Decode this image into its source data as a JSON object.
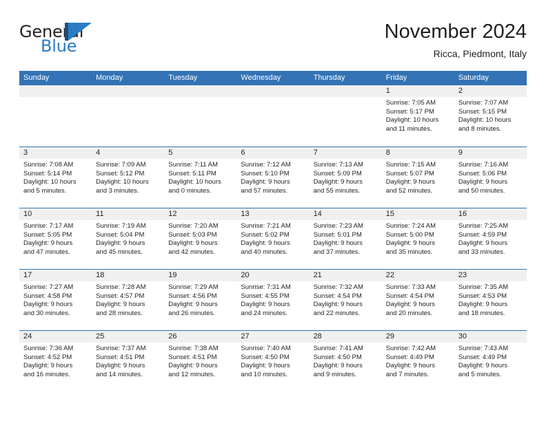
{
  "brand": {
    "name_part1": "General",
    "name_part2": "Blue",
    "logo_icon": "general-blue-triangle-logo",
    "dark_blue": "#1a4f86",
    "accent_blue": "#2b7cc4"
  },
  "header": {
    "month_title": "November 2024",
    "location": "Ricca, Piedmont, Italy"
  },
  "theme": {
    "header_row_blue": "#3373b5",
    "day_strip_gray": "#f0f0f0",
    "text_color": "#231f20"
  },
  "weekdays": [
    {
      "label": "Sunday"
    },
    {
      "label": "Monday"
    },
    {
      "label": "Tuesday"
    },
    {
      "label": "Wednesday"
    },
    {
      "label": "Thursday"
    },
    {
      "label": "Friday"
    },
    {
      "label": "Saturday"
    }
  ],
  "weeks": [
    {
      "days": [
        {
          "number": "",
          "sunrise": "",
          "sunset": "",
          "daylight_line1": "",
          "daylight_line2": "",
          "empty": true
        },
        {
          "number": "",
          "sunrise": "",
          "sunset": "",
          "daylight_line1": "",
          "daylight_line2": "",
          "empty": true
        },
        {
          "number": "",
          "sunrise": "",
          "sunset": "",
          "daylight_line1": "",
          "daylight_line2": "",
          "empty": true
        },
        {
          "number": "",
          "sunrise": "",
          "sunset": "",
          "daylight_line1": "",
          "daylight_line2": "",
          "empty": true
        },
        {
          "number": "",
          "sunrise": "",
          "sunset": "",
          "daylight_line1": "",
          "daylight_line2": "",
          "empty": true
        },
        {
          "number": "1",
          "sunrise": "Sunrise: 7:05 AM",
          "sunset": "Sunset: 5:17 PM",
          "daylight_line1": "Daylight: 10 hours",
          "daylight_line2": "and 11 minutes.",
          "empty": false
        },
        {
          "number": "2",
          "sunrise": "Sunrise: 7:07 AM",
          "sunset": "Sunset: 5:15 PM",
          "daylight_line1": "Daylight: 10 hours",
          "daylight_line2": "and 8 minutes.",
          "empty": false
        }
      ]
    },
    {
      "days": [
        {
          "number": "3",
          "sunrise": "Sunrise: 7:08 AM",
          "sunset": "Sunset: 5:14 PM",
          "daylight_line1": "Daylight: 10 hours",
          "daylight_line2": "and 5 minutes.",
          "empty": false
        },
        {
          "number": "4",
          "sunrise": "Sunrise: 7:09 AM",
          "sunset": "Sunset: 5:12 PM",
          "daylight_line1": "Daylight: 10 hours",
          "daylight_line2": "and 3 minutes.",
          "empty": false
        },
        {
          "number": "5",
          "sunrise": "Sunrise: 7:11 AM",
          "sunset": "Sunset: 5:11 PM",
          "daylight_line1": "Daylight: 10 hours",
          "daylight_line2": "and 0 minutes.",
          "empty": false
        },
        {
          "number": "6",
          "sunrise": "Sunrise: 7:12 AM",
          "sunset": "Sunset: 5:10 PM",
          "daylight_line1": "Daylight: 9 hours",
          "daylight_line2": "and 57 minutes.",
          "empty": false
        },
        {
          "number": "7",
          "sunrise": "Sunrise: 7:13 AM",
          "sunset": "Sunset: 5:09 PM",
          "daylight_line1": "Daylight: 9 hours",
          "daylight_line2": "and 55 minutes.",
          "empty": false
        },
        {
          "number": "8",
          "sunrise": "Sunrise: 7:15 AM",
          "sunset": "Sunset: 5:07 PM",
          "daylight_line1": "Daylight: 9 hours",
          "daylight_line2": "and 52 minutes.",
          "empty": false
        },
        {
          "number": "9",
          "sunrise": "Sunrise: 7:16 AM",
          "sunset": "Sunset: 5:06 PM",
          "daylight_line1": "Daylight: 9 hours",
          "daylight_line2": "and 50 minutes.",
          "empty": false
        }
      ]
    },
    {
      "days": [
        {
          "number": "10",
          "sunrise": "Sunrise: 7:17 AM",
          "sunset": "Sunset: 5:05 PM",
          "daylight_line1": "Daylight: 9 hours",
          "daylight_line2": "and 47 minutes.",
          "empty": false
        },
        {
          "number": "11",
          "sunrise": "Sunrise: 7:19 AM",
          "sunset": "Sunset: 5:04 PM",
          "daylight_line1": "Daylight: 9 hours",
          "daylight_line2": "and 45 minutes.",
          "empty": false
        },
        {
          "number": "12",
          "sunrise": "Sunrise: 7:20 AM",
          "sunset": "Sunset: 5:03 PM",
          "daylight_line1": "Daylight: 9 hours",
          "daylight_line2": "and 42 minutes.",
          "empty": false
        },
        {
          "number": "13",
          "sunrise": "Sunrise: 7:21 AM",
          "sunset": "Sunset: 5:02 PM",
          "daylight_line1": "Daylight: 9 hours",
          "daylight_line2": "and 40 minutes.",
          "empty": false
        },
        {
          "number": "14",
          "sunrise": "Sunrise: 7:23 AM",
          "sunset": "Sunset: 5:01 PM",
          "daylight_line1": "Daylight: 9 hours",
          "daylight_line2": "and 37 minutes.",
          "empty": false
        },
        {
          "number": "15",
          "sunrise": "Sunrise: 7:24 AM",
          "sunset": "Sunset: 5:00 PM",
          "daylight_line1": "Daylight: 9 hours",
          "daylight_line2": "and 35 minutes.",
          "empty": false
        },
        {
          "number": "16",
          "sunrise": "Sunrise: 7:25 AM",
          "sunset": "Sunset: 4:59 PM",
          "daylight_line1": "Daylight: 9 hours",
          "daylight_line2": "and 33 minutes.",
          "empty": false
        }
      ]
    },
    {
      "days": [
        {
          "number": "17",
          "sunrise": "Sunrise: 7:27 AM",
          "sunset": "Sunset: 4:58 PM",
          "daylight_line1": "Daylight: 9 hours",
          "daylight_line2": "and 30 minutes.",
          "empty": false
        },
        {
          "number": "18",
          "sunrise": "Sunrise: 7:28 AM",
          "sunset": "Sunset: 4:57 PM",
          "daylight_line1": "Daylight: 9 hours",
          "daylight_line2": "and 28 minutes.",
          "empty": false
        },
        {
          "number": "19",
          "sunrise": "Sunrise: 7:29 AM",
          "sunset": "Sunset: 4:56 PM",
          "daylight_line1": "Daylight: 9 hours",
          "daylight_line2": "and 26 minutes.",
          "empty": false
        },
        {
          "number": "20",
          "sunrise": "Sunrise: 7:31 AM",
          "sunset": "Sunset: 4:55 PM",
          "daylight_line1": "Daylight: 9 hours",
          "daylight_line2": "and 24 minutes.",
          "empty": false
        },
        {
          "number": "21",
          "sunrise": "Sunrise: 7:32 AM",
          "sunset": "Sunset: 4:54 PM",
          "daylight_line1": "Daylight: 9 hours",
          "daylight_line2": "and 22 minutes.",
          "empty": false
        },
        {
          "number": "22",
          "sunrise": "Sunrise: 7:33 AM",
          "sunset": "Sunset: 4:54 PM",
          "daylight_line1": "Daylight: 9 hours",
          "daylight_line2": "and 20 minutes.",
          "empty": false
        },
        {
          "number": "23",
          "sunrise": "Sunrise: 7:35 AM",
          "sunset": "Sunset: 4:53 PM",
          "daylight_line1": "Daylight: 9 hours",
          "daylight_line2": "and 18 minutes.",
          "empty": false
        }
      ]
    },
    {
      "days": [
        {
          "number": "24",
          "sunrise": "Sunrise: 7:36 AM",
          "sunset": "Sunset: 4:52 PM",
          "daylight_line1": "Daylight: 9 hours",
          "daylight_line2": "and 16 minutes.",
          "empty": false
        },
        {
          "number": "25",
          "sunrise": "Sunrise: 7:37 AM",
          "sunset": "Sunset: 4:51 PM",
          "daylight_line1": "Daylight: 9 hours",
          "daylight_line2": "and 14 minutes.",
          "empty": false
        },
        {
          "number": "26",
          "sunrise": "Sunrise: 7:38 AM",
          "sunset": "Sunset: 4:51 PM",
          "daylight_line1": "Daylight: 9 hours",
          "daylight_line2": "and 12 minutes.",
          "empty": false
        },
        {
          "number": "27",
          "sunrise": "Sunrise: 7:40 AM",
          "sunset": "Sunset: 4:50 PM",
          "daylight_line1": "Daylight: 9 hours",
          "daylight_line2": "and 10 minutes.",
          "empty": false
        },
        {
          "number": "28",
          "sunrise": "Sunrise: 7:41 AM",
          "sunset": "Sunset: 4:50 PM",
          "daylight_line1": "Daylight: 9 hours",
          "daylight_line2": "and 9 minutes.",
          "empty": false
        },
        {
          "number": "29",
          "sunrise": "Sunrise: 7:42 AM",
          "sunset": "Sunset: 4:49 PM",
          "daylight_line1": "Daylight: 9 hours",
          "daylight_line2": "and 7 minutes.",
          "empty": false
        },
        {
          "number": "30",
          "sunrise": "Sunrise: 7:43 AM",
          "sunset": "Sunset: 4:49 PM",
          "daylight_line1": "Daylight: 9 hours",
          "daylight_line2": "and 5 minutes.",
          "empty": false
        }
      ]
    }
  ]
}
